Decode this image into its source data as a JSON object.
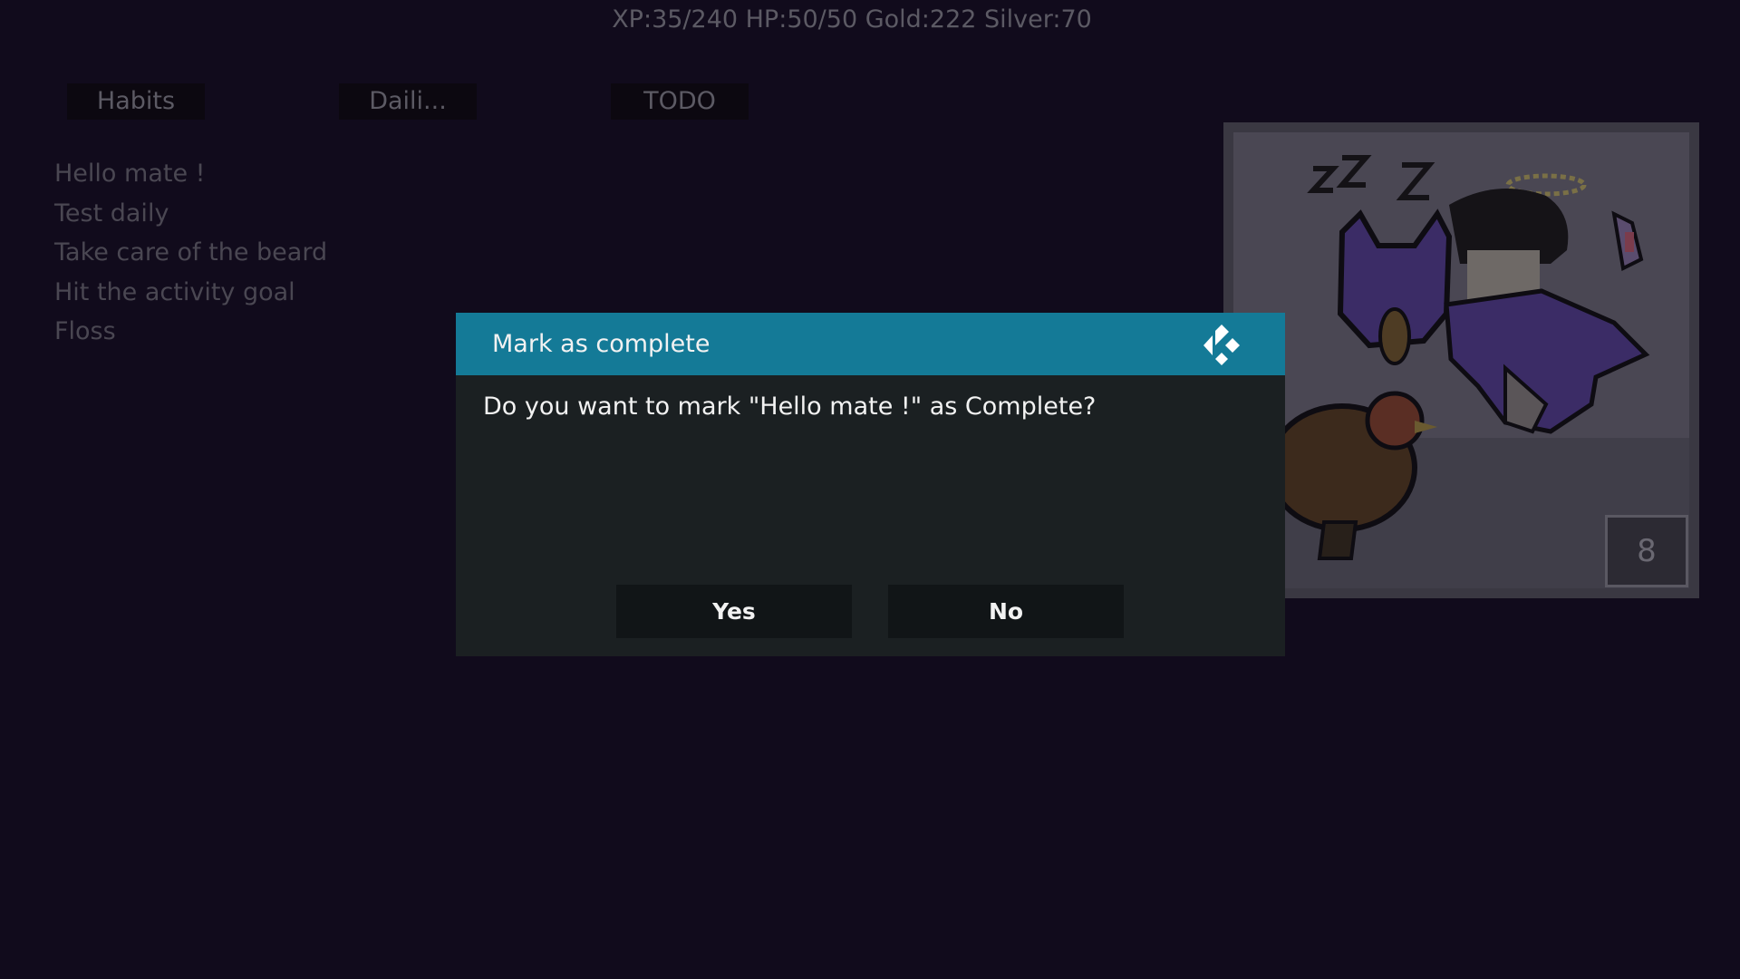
{
  "status_bar": {
    "stats": "XP:35/240 HP:50/50 Gold:222 Silver:70"
  },
  "tabs": [
    {
      "label": "Habits"
    },
    {
      "label": "Daili..."
    },
    {
      "label": "TODO"
    }
  ],
  "tasks": [
    {
      "label": "Hello mate !"
    },
    {
      "label": "Test daily"
    },
    {
      "label": "Take care of the beard"
    },
    {
      "label": "Hit the activity goal"
    },
    {
      "label": "Floss"
    }
  ],
  "avatar": {
    "badge": "8",
    "sleeping_text": "zZZ"
  },
  "dialog": {
    "title": "Mark as complete",
    "message": "Do you want to mark \"Hello mate !\" as Complete?",
    "yes_label": "Yes",
    "no_label": "No",
    "icon": "kodi-logo-icon"
  },
  "colors": {
    "background": "#110b1c",
    "dialog_header": "#147a97",
    "dialog_body": "#1b2022",
    "button": "#111517"
  }
}
